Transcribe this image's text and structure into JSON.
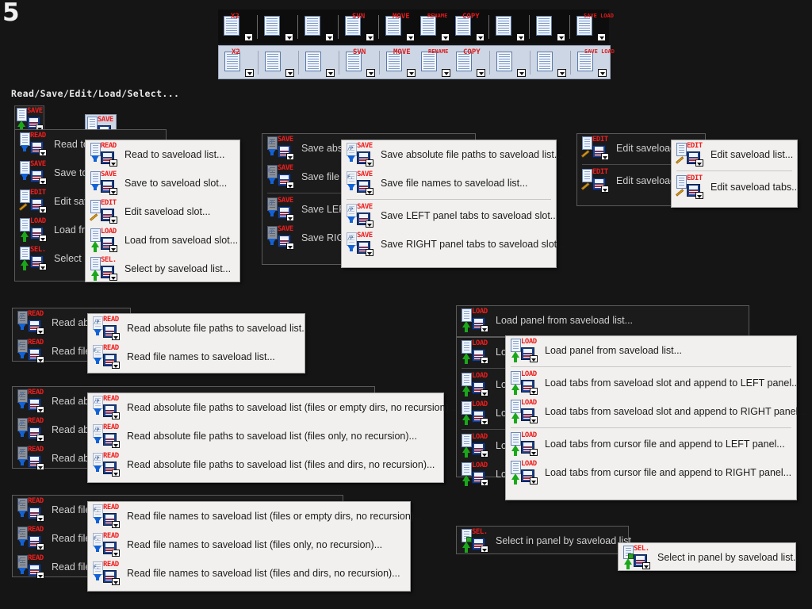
{
  "page_number": "5",
  "caption": "Read/Save/Edit/Load/Select...",
  "colors": {
    "background": "#151515",
    "menu_front_bg": "#f1f0ee",
    "menu_back_bg": "#1b1b1b",
    "toolbar_light_bg": "#cdd6e4",
    "tag_red": "#ef1d1d",
    "arrow_down_blue": "#1262d6",
    "arrow_up_green": "#1aa81a"
  },
  "toolbars": [
    {
      "name": "toolbar-row-dark",
      "style": "dark",
      "buttons": [
        {
          "icon": "calendar-x2-icon",
          "tag": "X2",
          "dropdown": true
        },
        {
          "icon": "edit-document-pencil-icon",
          "tag": "",
          "dropdown": true
        },
        {
          "icon": "file-swap-arrows-icon",
          "tag": "",
          "dropdown": true
        },
        {
          "icon": "svn-turtle-icon",
          "tag": "SVN",
          "dropdown": true
        },
        {
          "icon": "move-files-icon",
          "tag": "MOVE",
          "dropdown": true
        },
        {
          "icon": "rename-files-icon",
          "tag": "RENAME",
          "dropdown": true
        },
        {
          "icon": "copy-files-icon",
          "tag": "COPY",
          "dropdown": true
        },
        {
          "icon": "new-folder-plus-icon",
          "tag": "",
          "dropdown": true
        },
        {
          "icon": "multimedia-clapper-icon",
          "tag": "",
          "dropdown": true
        },
        {
          "icon": "saveload-icon",
          "tag": "SAVE LOAD",
          "dropdown": true
        }
      ]
    },
    {
      "name": "toolbar-row-light",
      "style": "light",
      "buttons": [
        {
          "icon": "calendar-x2-icon",
          "tag": "X2",
          "dropdown": true
        },
        {
          "icon": "edit-document-pencil-icon",
          "tag": "",
          "dropdown": true
        },
        {
          "icon": "file-swap-arrows-icon",
          "tag": "",
          "dropdown": true
        },
        {
          "icon": "svn-turtle-icon",
          "tag": "SVN",
          "dropdown": true
        },
        {
          "icon": "move-files-icon",
          "tag": "MOVE",
          "dropdown": true
        },
        {
          "icon": "rename-files-icon",
          "tag": "RENAME",
          "dropdown": true
        },
        {
          "icon": "copy-files-icon",
          "tag": "COPY",
          "dropdown": true
        },
        {
          "icon": "new-folder-plus-icon",
          "tag": "",
          "dropdown": true
        },
        {
          "icon": "multimedia-clapper-icon",
          "tag": "",
          "dropdown": true
        },
        {
          "icon": "saveload-icon",
          "tag": "SAVE LOAD",
          "dropdown": true
        }
      ]
    }
  ],
  "menus": {
    "saveload_root_back": {
      "name": "saveload-root-menu-back",
      "items": [
        {
          "tag": "READ",
          "arrow": "down",
          "label": "Read to saveload list..."
        },
        {
          "tag": "SAVE",
          "arrow": "down",
          "label": "Save to saveload slot..."
        },
        {
          "tag": "EDIT",
          "arrow": "pencil",
          "label": "Edit saveload slot..."
        },
        {
          "tag": "LOAD",
          "arrow": "up",
          "label": "Load from saveload slot..."
        },
        {
          "tag": "SEL.",
          "arrow": "up",
          "label": "Select by saveload list..."
        }
      ]
    },
    "saveload_root_front": {
      "name": "saveload-root-menu-front",
      "items": [
        {
          "tag": "READ",
          "arrow": "down",
          "label": "Read to saveload list..."
        },
        {
          "tag": "SAVE",
          "arrow": "down",
          "label": "Save to saveload slot..."
        },
        {
          "tag": "EDIT",
          "arrow": "pencil",
          "label": "Edit saveload slot..."
        },
        {
          "tag": "LOAD",
          "arrow": "up",
          "label": "Load from saveload slot..."
        },
        {
          "tag": "SEL.",
          "arrow": "up",
          "label": "Select by saveload list..."
        }
      ]
    },
    "save_back": {
      "name": "save-menu-back",
      "items": [
        {
          "tag": "SAVE",
          "arrow": "down",
          "pgtxt": "/P",
          "label": "Save absolute file paths to saveload list..."
        },
        {
          "tag": "SAVE",
          "arrow": "down",
          "pgtxt": "F.",
          "label": "Save file names to saveload list..."
        },
        {
          "separator": true
        },
        {
          "tag": "SAVE",
          "arrow": "down",
          "pgtxt": "/P",
          "label": "Save LEFT panel tabs to saveload slot..."
        },
        {
          "tag": "SAVE",
          "arrow": "down",
          "pgtxt": "/P",
          "label": "Save RIGHT panel tabs to saveload slot..."
        }
      ]
    },
    "save_front": {
      "name": "save-menu-front",
      "items": [
        {
          "tag": "SAVE",
          "arrow": "down",
          "pgtxt": "/P",
          "label": "Save absolute file paths to saveload list..."
        },
        {
          "tag": "SAVE",
          "arrow": "down",
          "pgtxt": "F.",
          "label": "Save file names to saveload list..."
        },
        {
          "separator": true
        },
        {
          "tag": "SAVE",
          "arrow": "down",
          "pgtxt": "/P",
          "label": "Save LEFT panel tabs to saveload slot..."
        },
        {
          "tag": "SAVE",
          "arrow": "down",
          "pgtxt": "/P",
          "label": "Save RIGHT panel tabs to saveload slot..."
        }
      ]
    },
    "edit_back": {
      "name": "edit-menu-back",
      "items": [
        {
          "tag": "EDIT",
          "arrow": "pencil",
          "label": "Edit saveload list..."
        },
        {
          "separator": true
        },
        {
          "tag": "EDIT",
          "arrow": "pencil",
          "label": "Edit saveload tabs..."
        }
      ]
    },
    "edit_front": {
      "name": "edit-menu-front",
      "items": [
        {
          "tag": "EDIT",
          "arrow": "pencil",
          "label": "Edit saveload list..."
        },
        {
          "separator": true
        },
        {
          "tag": "EDIT",
          "arrow": "pencil",
          "label": "Edit saveload tabs..."
        }
      ]
    },
    "read_back": {
      "name": "read-menu-back",
      "items": [
        {
          "tag": "READ",
          "arrow": "down",
          "pgtxt": "/P",
          "label": "Read absolute file paths to saveload list..."
        },
        {
          "tag": "READ",
          "arrow": "down",
          "pgtxt": "F.",
          "label": "Read file names to saveload list..."
        }
      ]
    },
    "read_front": {
      "name": "read-menu-front",
      "items": [
        {
          "tag": "READ",
          "arrow": "down",
          "pgtxt": "/P",
          "label": "Read absolute file paths to saveload list..."
        },
        {
          "tag": "READ",
          "arrow": "down",
          "pgtxt": "F.",
          "label": "Read file names to saveload list..."
        }
      ]
    },
    "read_paths_back": {
      "name": "read-absolute-paths-menu-back",
      "items": [
        {
          "tag": "READ",
          "arrow": "down",
          "pgtxt": "/P",
          "label": "Read absolute file paths to saveload list (files or empty dirs, no recursion)..."
        },
        {
          "tag": "READ",
          "arrow": "down",
          "pgtxt": "/P",
          "label": "Read absolute file paths to saveload list (files only, no recursion)..."
        },
        {
          "tag": "READ",
          "arrow": "down",
          "pgtxt": "/P",
          "label": "Read absolute file paths to saveload list (files and dirs, no recursion)..."
        }
      ]
    },
    "read_paths_front": {
      "name": "read-absolute-paths-menu-front",
      "items": [
        {
          "tag": "READ",
          "arrow": "down",
          "pgtxt": "/P",
          "label": "Read absolute file paths to saveload list (files or empty dirs, no recursion)..."
        },
        {
          "tag": "READ",
          "arrow": "down",
          "pgtxt": "/P",
          "label": "Read absolute file paths to saveload list (files only, no recursion)..."
        },
        {
          "tag": "READ",
          "arrow": "down",
          "pgtxt": "/P",
          "label": "Read absolute file paths to saveload list (files and dirs, no recursion)..."
        }
      ]
    },
    "read_names_back": {
      "name": "read-file-names-menu-back",
      "items": [
        {
          "tag": "READ",
          "arrow": "down",
          "pgtxt": "F.",
          "label": "Read file names to saveload list (files or empty dirs, no recursion)..."
        },
        {
          "tag": "READ",
          "arrow": "down",
          "pgtxt": "F.",
          "label": "Read file names to saveload list (files only, no recursion)..."
        },
        {
          "tag": "READ",
          "arrow": "down",
          "pgtxt": "F.",
          "label": "Read file names to saveload list (files and dirs, no recursion)..."
        }
      ]
    },
    "read_names_front": {
      "name": "read-file-names-menu-front",
      "items": [
        {
          "tag": "READ",
          "arrow": "down",
          "pgtxt": "F.",
          "label": "Read file names to saveload list (files or empty dirs, no recursion)..."
        },
        {
          "tag": "READ",
          "arrow": "down",
          "pgtxt": "F.",
          "label": "Read file names to saveload list (files only, no recursion)..."
        },
        {
          "tag": "READ",
          "arrow": "down",
          "pgtxt": "F.",
          "label": "Read file names to saveload list (files and dirs, no recursion)..."
        }
      ]
    },
    "load_top_back": {
      "name": "load-panel-top-menu-back",
      "items": [
        {
          "tag": "LOAD",
          "arrow": "up",
          "label": "Load panel from saveload list..."
        }
      ]
    },
    "load_back": {
      "name": "load-menu-back",
      "items": [
        {
          "tag": "LOAD",
          "arrow": "up",
          "label": "Load panel from saveload list..."
        },
        {
          "separator": true
        },
        {
          "tag": "LOAD",
          "arrow": "up",
          "label": "Load tabs from saveload slot and append to LEFT panel..."
        },
        {
          "tag": "LOAD",
          "arrow": "up",
          "label": "Load tabs from saveload slot and append to RIGHT panel..."
        },
        {
          "separator": true
        },
        {
          "tag": "LOAD",
          "arrow": "up",
          "label": "Load tabs from cursor file and append to LEFT panel..."
        },
        {
          "tag": "LOAD",
          "arrow": "up",
          "label": "Load tabs from cursor file and append to RIGHT panel..."
        }
      ]
    },
    "load_front": {
      "name": "load-menu-front",
      "items": [
        {
          "tag": "LOAD",
          "arrow": "up",
          "label": "Load panel from saveload list..."
        },
        {
          "separator": true
        },
        {
          "tag": "LOAD",
          "arrow": "up",
          "label": "Load tabs from saveload slot and append to LEFT panel..."
        },
        {
          "tag": "LOAD",
          "arrow": "up",
          "label": "Load tabs from saveload slot and append to RIGHT panel..."
        },
        {
          "separator": true
        },
        {
          "tag": "LOAD",
          "arrow": "up",
          "label": "Load tabs from cursor file and append to LEFT panel..."
        },
        {
          "tag": "LOAD",
          "arrow": "up",
          "label": "Load tabs from cursor file and append to RIGHT panel..."
        }
      ]
    },
    "select_back": {
      "name": "select-menu-back",
      "items": [
        {
          "tag": "SEL.",
          "arrow": "up",
          "check": true,
          "label": "Select in panel by saveload list"
        }
      ]
    },
    "select_front": {
      "name": "select-menu-front",
      "items": [
        {
          "tag": "SEL.",
          "arrow": "up",
          "check": true,
          "label": "Select in panel by saveload list..."
        }
      ]
    }
  }
}
